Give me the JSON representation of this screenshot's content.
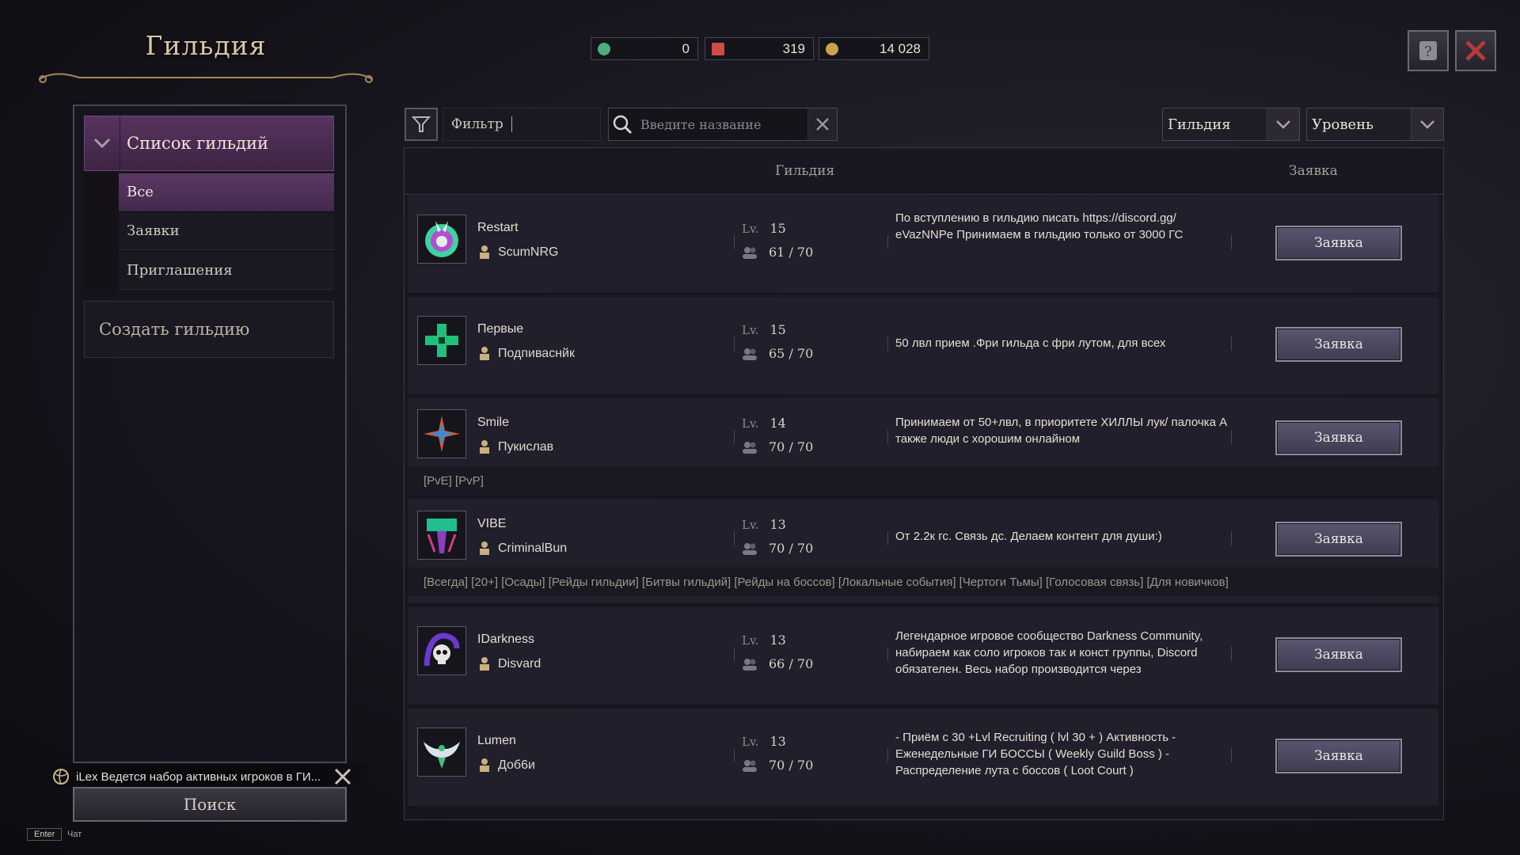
{
  "title": "Гильдия",
  "currencies": [
    {
      "icon": "green-gem-icon",
      "value": "0",
      "color": "#4caf7d"
    },
    {
      "icon": "red-crystal-icon",
      "value": "319",
      "color": "#d24a4a"
    },
    {
      "icon": "gold-coin-icon",
      "value": "14 028",
      "color": "#c9a24a"
    }
  ],
  "sidebar": {
    "category": "Список гильдий",
    "items": [
      {
        "label": "Все",
        "active": true
      },
      {
        "label": "Заявки",
        "active": false
      },
      {
        "label": "Приглашения",
        "active": false
      }
    ],
    "create": "Создать гильдию",
    "search_button": "Поиск"
  },
  "chat": {
    "message": "iLex  Ведется набор активных игроков в ГИ...",
    "enter_key": "Enter",
    "label": "Чат"
  },
  "toolbar": {
    "filter_label": "Фильтр",
    "search_placeholder": "Введите название",
    "dropdown_guild": "Гильдия",
    "dropdown_level": "Уровень"
  },
  "table": {
    "col_guild": "Гильдия",
    "col_application": "Заявка",
    "level_tag": "Lv.",
    "apply_label": "Заявка",
    "rows": [
      {
        "name": "Restart",
        "leader": "ScumNRG",
        "level": "15",
        "members": "61 / 70",
        "desc": "По вступлению в гильдию писать https://discord.gg/ eVazNNPe Принимаем в гильдию только от 3000 ГС",
        "tags": ""
      },
      {
        "name": "Первые",
        "leader": "Подпиваснйк",
        "level": "15",
        "members": "65 / 70",
        "desc": "50 лвл  прием .Фри гильда с фри лутом, для всех",
        "tags": ""
      },
      {
        "name": "Smile",
        "leader": "Пукислав",
        "level": "14",
        "members": "70 / 70",
        "desc": "Принимаем от 50+лвл, в приоритете ХИЛЛЫ лук/ палочка А также люди с хорошим онлайном",
        "tags": "[PvE] [PvP]"
      },
      {
        "name": "VIBE",
        "leader": "CriminalBun",
        "level": "13",
        "members": "70 / 70",
        "desc": "От 2.2к гс. Связь дс. Делаем контент для души:)",
        "tags": "[Всегда] [20+] [Осады] [Рейды гильдии] [Битвы гильдий] [Рейды на боссов] [Локальные события] [Чертоги Тьмы] [Голосовая связь] [Для новичков]"
      },
      {
        "name": "IDarkness",
        "leader": "Disvard",
        "level": "13",
        "members": "66 / 70",
        "desc": "Легендарное игровое сообщество Darkness Community, набираем как соло игроков так и конст группы, Discord обязателен. Весь набор производится через",
        "tags": ""
      },
      {
        "name": "Lumen",
        "leader": "Доб6и",
        "level": "13",
        "members": "70 / 70",
        "desc": "- Приём с 30 +Lvl Recruiting ( lvl 30 + ) Активность - Еженедельные ГИ БОССЫ ( Weekly Guild Boss ) - Распределение лута с боссов ( Loot Court )",
        "tags": ""
      }
    ]
  }
}
